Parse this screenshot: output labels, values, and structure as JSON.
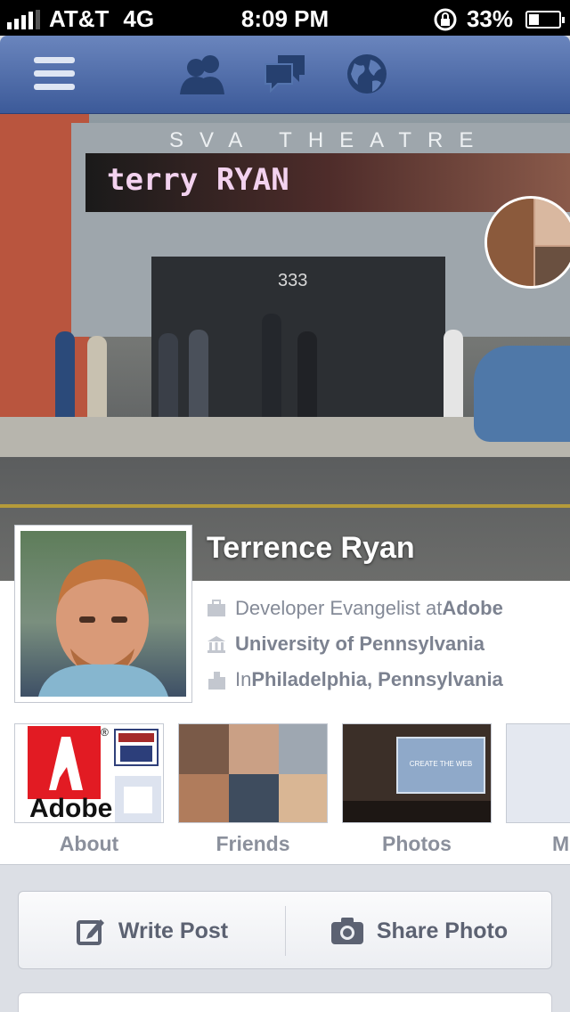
{
  "status_bar": {
    "carrier": "AT&T",
    "network": "4G",
    "time": "8:09 PM",
    "battery_percent_label": "33%",
    "battery_level": 0.33
  },
  "nav": {
    "icons": [
      "menu-icon",
      "friend-requests-icon",
      "messages-icon",
      "notifications-globe-icon"
    ]
  },
  "cover": {
    "theatre_sign": "SVA THEATRE",
    "marquee_text": "terry RYAN",
    "address_number": "333"
  },
  "profile": {
    "name": "Terrence Ryan",
    "info": [
      {
        "icon": "briefcase-icon",
        "prefix": "Developer Evangelist at ",
        "value": "Adobe"
      },
      {
        "icon": "school-icon",
        "prefix": "",
        "value": "University of Pennsylvania"
      },
      {
        "icon": "city-icon",
        "prefix": "In ",
        "value": "Philadelphia, Pennsylvania"
      }
    ]
  },
  "tiles": [
    {
      "label": "About",
      "logo_text": "Adobe"
    },
    {
      "label": "Friends"
    },
    {
      "label": "Photos",
      "screen_text": "CREATE THE WEB"
    },
    {
      "label": "M"
    }
  ],
  "actions": {
    "write_post": "Write Post",
    "share_photo": "Share Photo"
  },
  "colors": {
    "nav_blue": "#3c5a99",
    "text_gray": "#848a97",
    "adobe_red": "#e21b23"
  }
}
